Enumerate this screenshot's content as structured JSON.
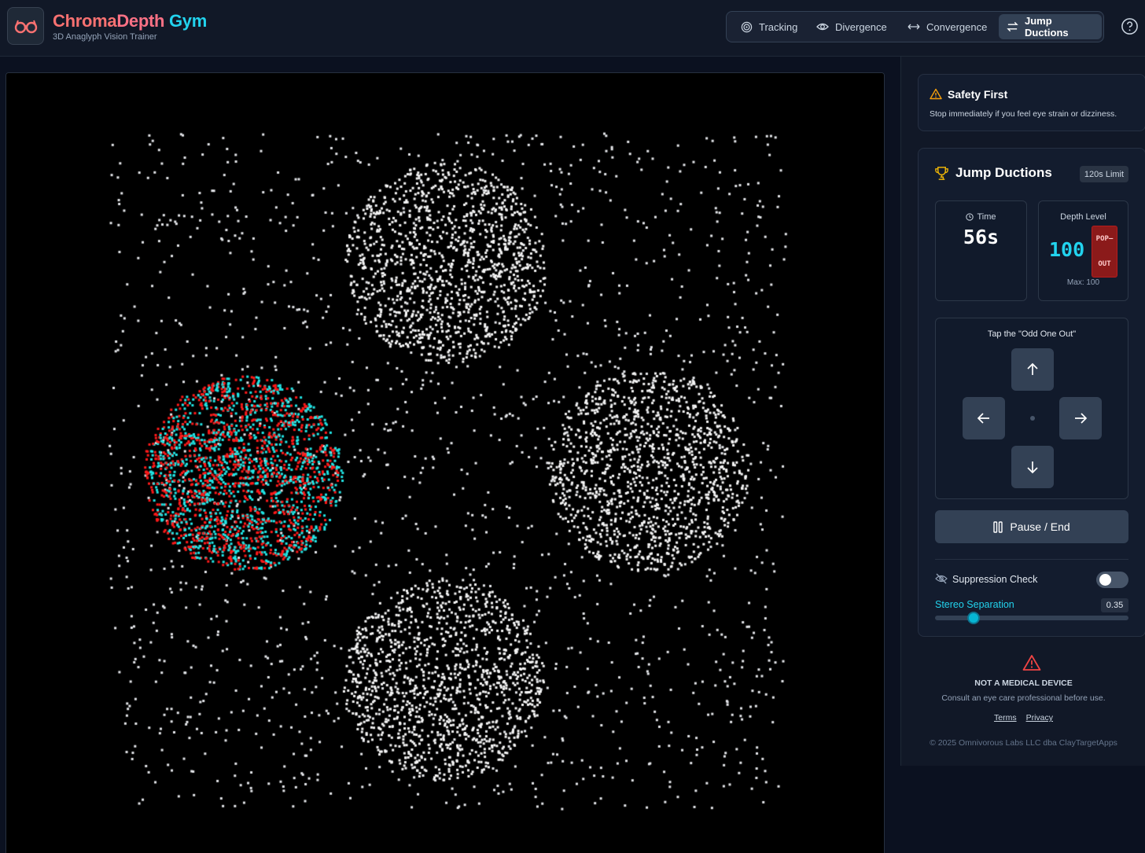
{
  "app": {
    "title_part1": "Chroma",
    "title_part2": "Depth",
    "title_part3": " Gym",
    "subtitle": "3D Anaglyph Vision Trainer",
    "logo_icon": "glasses-icon"
  },
  "nav": {
    "items": [
      {
        "label": "Tracking",
        "icon": "target-icon",
        "active": false
      },
      {
        "label": "Divergence",
        "icon": "eye-icon",
        "active": false
      },
      {
        "label": "Convergence",
        "icon": "arrows-horizontal-icon",
        "active": false
      },
      {
        "label": "Jump Ductions",
        "icon": "swap-icon",
        "active": true
      }
    ],
    "help_icon": "help-circle-icon"
  },
  "safety": {
    "title": "Safety First",
    "text": "Stop immediately if you feel eye strain or dizziness."
  },
  "exercise": {
    "title": "Jump Ductions",
    "limit_badge": "120s Limit",
    "time_label": "Time",
    "time_value": "56s",
    "depth_label": "Depth Level",
    "depth_value": "100",
    "depth_mode_line1": "POP–",
    "depth_mode_line2": "OUT",
    "depth_max": "Max: 100",
    "dpad_label": "Tap the \"Odd One Out\"",
    "pause_label": "Pause / End",
    "suppression_label": "Suppression Check",
    "suppression_on": false,
    "stereo_label": "Stereo Separation",
    "stereo_value": "0.35",
    "stereo_fraction": 0.2
  },
  "colors": {
    "red": "#ff1a1a",
    "cyan": "#22e5e5",
    "accent": "#22d3ee",
    "brand_red": "#f87171"
  },
  "footer": {
    "warning": "NOT A MEDICAL DEVICE",
    "consult": "Consult an eye care professional before use.",
    "terms": "Terms",
    "privacy": "Privacy",
    "copyright": "© 2025 Omnivorous Labs LLC dba ClayTargetApps"
  }
}
